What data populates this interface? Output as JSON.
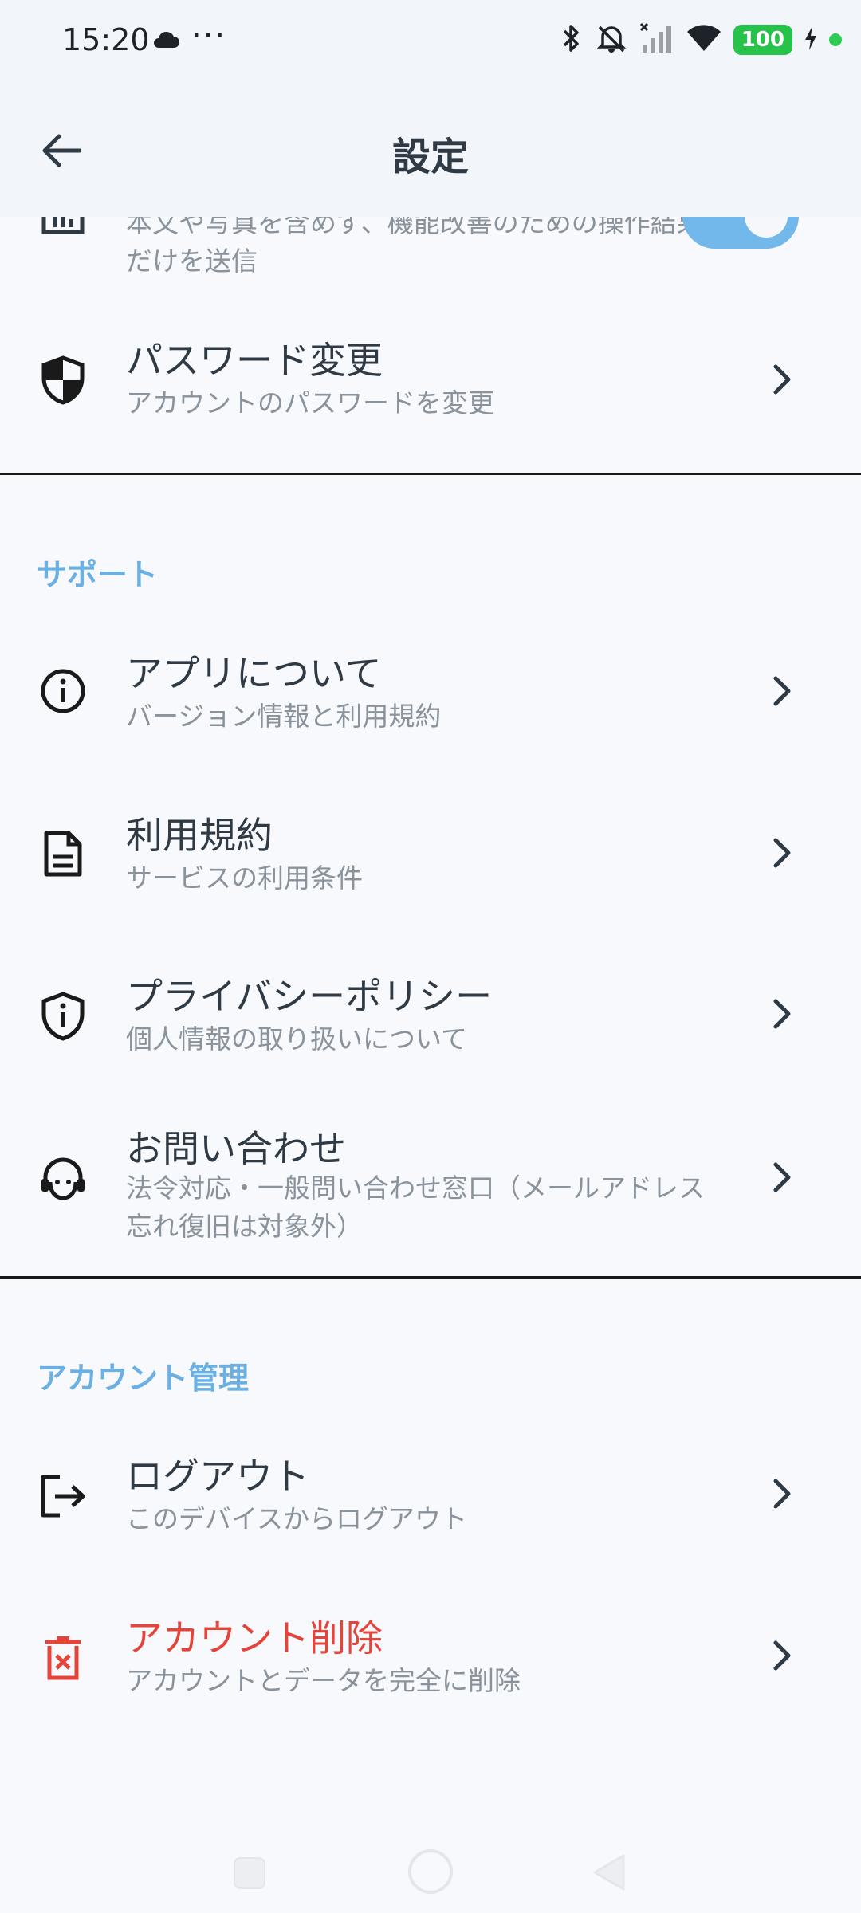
{
  "status_bar": {
    "time": "15:20",
    "dots": "···",
    "battery": "100",
    "icons": [
      "cloud-icon",
      "bluetooth-icon",
      "bell-off-icon",
      "signal-icon",
      "wifi-icon",
      "battery-icon",
      "charging-icon"
    ]
  },
  "app_bar": {
    "title": "設定"
  },
  "items": {
    "analytics": {
      "subtitle": "本文や写真を含めず、機能改善のための操作結果だけを送信",
      "toggle_on": true
    },
    "password": {
      "title": "パスワード変更",
      "subtitle": "アカウントのパスワードを変更"
    },
    "about": {
      "title": "アプリについて",
      "subtitle": "バージョン情報と利用規約"
    },
    "terms": {
      "title": "利用規約",
      "subtitle": "サービスの利用条件"
    },
    "privacy": {
      "title": "プライバシーポリシー",
      "subtitle": "個人情報の取り扱いについて"
    },
    "contact": {
      "title": "お問い合わせ",
      "subtitle": "法令対応・一般問い合わせ窓口（メールアドレス忘れ復旧は対象外）"
    },
    "logout": {
      "title": "ログアウト",
      "subtitle": "このデバイスからログアウト"
    },
    "delete": {
      "title": "アカウント削除",
      "subtitle": "アカウントとデータを完全に削除"
    }
  },
  "sections": {
    "support": "サポート",
    "account": "アカウント管理"
  },
  "colors": {
    "accent": "#6ab0e2",
    "danger": "#e5443b",
    "toggle": "#72b8ea",
    "battery": "#27c24a"
  }
}
